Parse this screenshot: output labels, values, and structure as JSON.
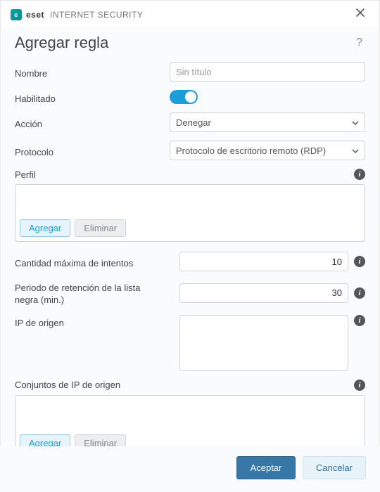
{
  "titlebar": {
    "brand_bold": "eset",
    "brand_light": "INTERNET SECURITY",
    "brand_badge": "e"
  },
  "header": {
    "title": "Agregar regla"
  },
  "fields": {
    "name_label": "Nombre",
    "name_placeholder": "Sin título",
    "name_value": "",
    "enabled_label": "Habilitado",
    "action_label": "Acción",
    "action_value": "Denegar",
    "protocol_label": "Protocolo",
    "protocol_value": "Protocolo de escritorio remoto (RDP)",
    "profile_label": "Perfil",
    "profile_add": "Agregar",
    "profile_delete": "Eliminar",
    "max_attempts_label": "Cantidad máxima de intentos",
    "max_attempts_value": "10",
    "retention_label": "Periodo de retención de la lista negra (min.)",
    "retention_value": "30",
    "source_ip_label": "IP de origen",
    "source_ip_sets_label": "Conjuntos de IP de origen",
    "ipsets_add": "Agregar",
    "ipsets_delete": "Eliminar"
  },
  "footer": {
    "accept": "Aceptar",
    "cancel": "Cancelar"
  }
}
